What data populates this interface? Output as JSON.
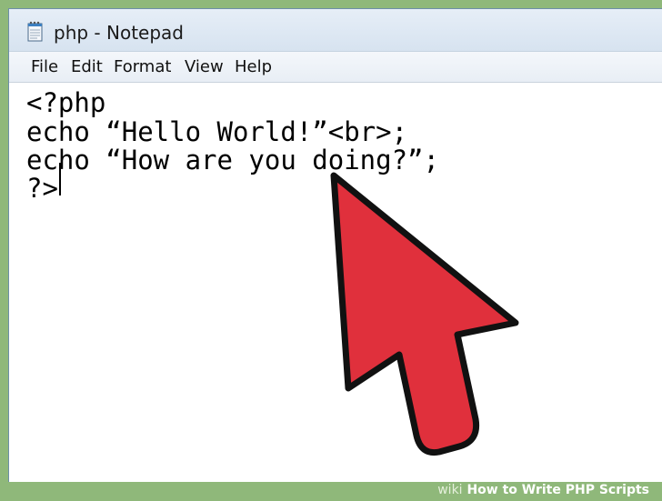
{
  "window": {
    "title": "php - Notepad",
    "app_icon": "notepad-icon"
  },
  "menubar": {
    "items": [
      "File",
      "Edit",
      "Format",
      "View",
      "Help"
    ]
  },
  "editor": {
    "lines": [
      "<?php",
      "echo “Hello World!”<br>;",
      "echo “How are you doing?”;",
      "?>"
    ]
  },
  "overlay": {
    "cursor_icon": "mouse-pointer-icon",
    "cursor_color": "#e0303c"
  },
  "footer": {
    "site": "wiki",
    "title": "How to Write PHP Scripts"
  },
  "colors": {
    "background": "#8fb87a",
    "titlebar": "#dde7f2"
  }
}
